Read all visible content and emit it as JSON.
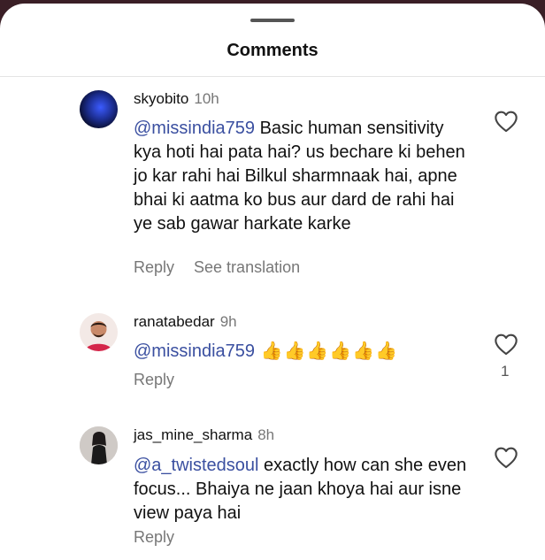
{
  "header": {
    "title": "Comments"
  },
  "comments": [
    {
      "username": "skyobito",
      "time": "10h",
      "mention": "@missindia759",
      "text": " Basic human sensitivity kya hoti hai pata hai? us bechare ki behen jo kar rahi hai Bilkul sharmnaak hai, apne bhai ki aatma ko bus aur dard de rahi hai ye sab gawar harkate karke",
      "reply_label": "Reply",
      "translate_label": "See translation",
      "like_count": ""
    },
    {
      "username": "ranatabedar",
      "time": "9h",
      "mention": "@missindia759",
      "text": " 👍👍👍👍👍👍",
      "reply_label": "Reply",
      "translate_label": "",
      "like_count": "1"
    },
    {
      "username": "jas_mine_sharma",
      "time": "8h",
      "mention": "@a_twistedsoul",
      "text": " exactly how can she even focus... Bhaiya ne jaan khoya hai aur isne view paya hai",
      "reply_label": "Reply",
      "translate_label": "",
      "like_count": ""
    }
  ],
  "colors": {
    "mention": "#3a4fa0",
    "muted": "#777777",
    "backdrop": "#3a1f26"
  }
}
